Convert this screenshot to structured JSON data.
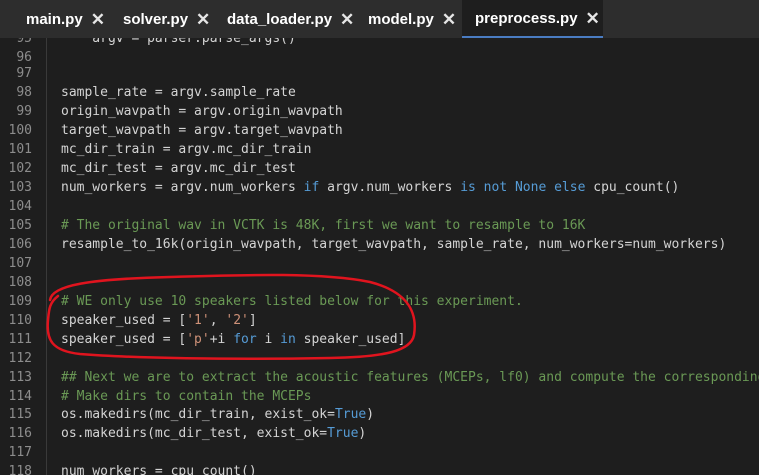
{
  "tabs": [
    {
      "label": "main.py",
      "active": false
    },
    {
      "label": "solver.py",
      "active": false
    },
    {
      "label": "data_loader.py",
      "active": false
    },
    {
      "label": "model.py",
      "active": false
    },
    {
      "label": "preprocess.py",
      "active": true
    }
  ],
  "close_glyph": "✕",
  "editor": {
    "lines": [
      {
        "num": "95",
        "text": "    argv = parser.parse_args()"
      },
      {
        "num": "96",
        "text": ""
      },
      {
        "num": "97",
        "text": ""
      },
      {
        "num": "98",
        "text": "sample_rate = argv.sample_rate"
      },
      {
        "num": "99",
        "text": "origin_wavpath = argv.origin_wavpath"
      },
      {
        "num": "100",
        "text": "target_wavpath = argv.target_wavpath"
      },
      {
        "num": "101",
        "text": "mc_dir_train = argv.mc_dir_train"
      },
      {
        "num": "102",
        "text": "mc_dir_test = argv.mc_dir_test"
      },
      {
        "num": "103",
        "p1": "num_workers = argv.num_workers ",
        "k1": "if",
        "p2": " argv.num_workers ",
        "k2": "is not None else",
        "p3": " cpu_count()"
      },
      {
        "num": "104",
        "text": ""
      },
      {
        "num": "105",
        "comment": "# The original wav in VCTK is 48K, first we want to resample to 16K"
      },
      {
        "num": "106",
        "text": "resample_to_16k(origin_wavpath, target_wavpath, sample_rate, num_workers=num_workers)"
      },
      {
        "num": "107",
        "text": ""
      },
      {
        "num": "108",
        "text": ""
      },
      {
        "num": "109",
        "comment": "# WE only use 10 speakers listed below for this experiment."
      },
      {
        "num": "110",
        "p1": "speaker_used = [",
        "s1": "'1'",
        "p2": ", ",
        "s2": "'2'",
        "p3": "]"
      },
      {
        "num": "111",
        "p1": "speaker_used = [",
        "s1": "'p'",
        "p2": "+i ",
        "k1": "for",
        "p3": " i ",
        "k2": "in",
        "p4": " speaker_used]"
      },
      {
        "num": "112",
        "text": ""
      },
      {
        "num": "113",
        "comment": "## Next we are to extract the acoustic features (MCEPs, lf0) and compute the corresponding stats (means, stds)."
      },
      {
        "num": "114",
        "comment": "# Make dirs to contain the MCEPs"
      },
      {
        "num": "115",
        "p1": "os.makedirs(mc_dir_train, exist_ok=",
        "k1": "True",
        "p2": ")"
      },
      {
        "num": "116",
        "p1": "os.makedirs(mc_dir_test, exist_ok=",
        "k1": "True",
        "p2": ")"
      },
      {
        "num": "117",
        "text": ""
      },
      {
        "num": "118",
        "text": "num_workers = cpu_count()"
      }
    ]
  },
  "colors": {
    "tab_bar": "#2d2d2d",
    "editor_bg": "#1e1e1e",
    "keyword": "#569cd6",
    "comment": "#6a9955",
    "string": "#ce9178",
    "annotation": "#e0141e",
    "active_tab_underline": "#4a7cc2"
  }
}
